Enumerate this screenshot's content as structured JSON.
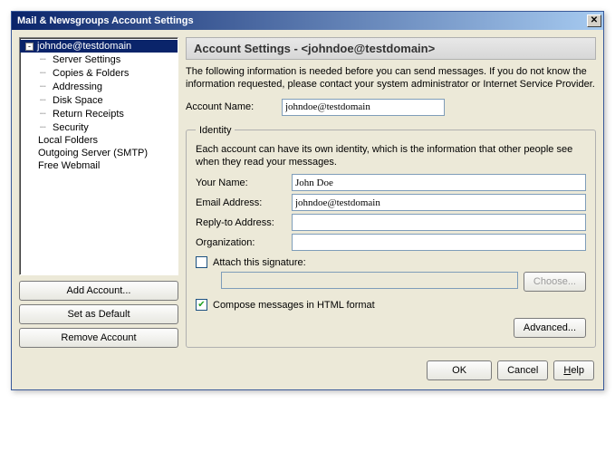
{
  "title": "Mail & Newsgroups Account Settings",
  "tree": {
    "account": "johndoe@testdomain",
    "children": [
      "Server Settings",
      "Copies & Folders",
      "Addressing",
      "Disk Space",
      "Return Receipts",
      "Security"
    ],
    "siblings": [
      "Local Folders",
      "Outgoing Server (SMTP)",
      "Free Webmail"
    ]
  },
  "sideButtons": {
    "add": "Add Account...",
    "default": "Set as Default",
    "remove": "Remove Account"
  },
  "header": {
    "prefix": "Account Settings - <",
    "account": "johndoe@testdomain",
    "suffix": ">"
  },
  "intro": "The following information is needed before you can send messages. If you do not know the information requested, please contact your system administrator or Internet Service Provider.",
  "accountNameLabel": "Account Name:",
  "accountName": "johndoe@testdomain",
  "identity": {
    "legend": "Identity",
    "desc": "Each account can have its own identity, which is the information that other people see when they read your messages.",
    "yourNameLabel": "Your Name:",
    "yourName": "John Doe",
    "emailLabel": "Email Address:",
    "email": "johndoe@testdomain",
    "replyLabel": "Reply-to Address:",
    "reply": "",
    "orgLabel": "Organization:",
    "org": "",
    "attachSigLabel": "Attach this signature:",
    "sigPath": "",
    "choose": "Choose...",
    "composeHtmlLabel": "Compose messages in HTML format",
    "advanced": "Advanced..."
  },
  "buttons": {
    "ok": "OK",
    "cancel": "Cancel",
    "help": "Help"
  }
}
